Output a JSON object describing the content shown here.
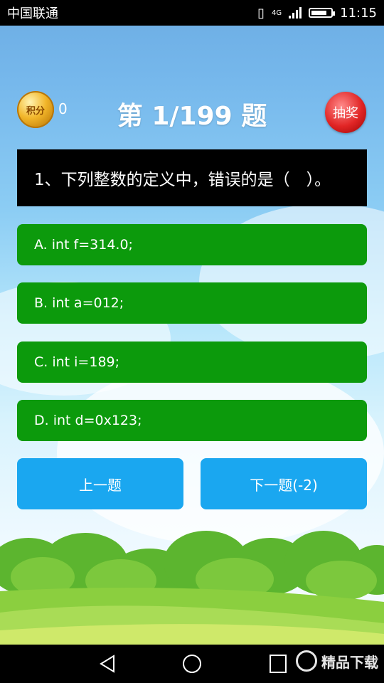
{
  "status": {
    "carrier": "中国联通",
    "network": "4G",
    "time": "11:15",
    "battery_level": 0.8
  },
  "header": {
    "coin_label": "积分",
    "score": "0",
    "title": "第 1/199 题",
    "draw_label": "抽奖"
  },
  "question": {
    "text": "1、下列整数的定义中，错误的是（　）。"
  },
  "options": [
    {
      "label": "A. int f=314.0;"
    },
    {
      "label": "B. int a=012;"
    },
    {
      "label": "C. int i=189;"
    },
    {
      "label": "D. int d=0x123;"
    }
  ],
  "navigation": {
    "prev_label": "上一题",
    "next_label": "下一题(-2)"
  },
  "colors": {
    "option_bg": "#0c9a0c",
    "nav_button_bg": "#1aa7f0",
    "question_bg": "#000000"
  },
  "watermark": {
    "text": "精品下载"
  }
}
